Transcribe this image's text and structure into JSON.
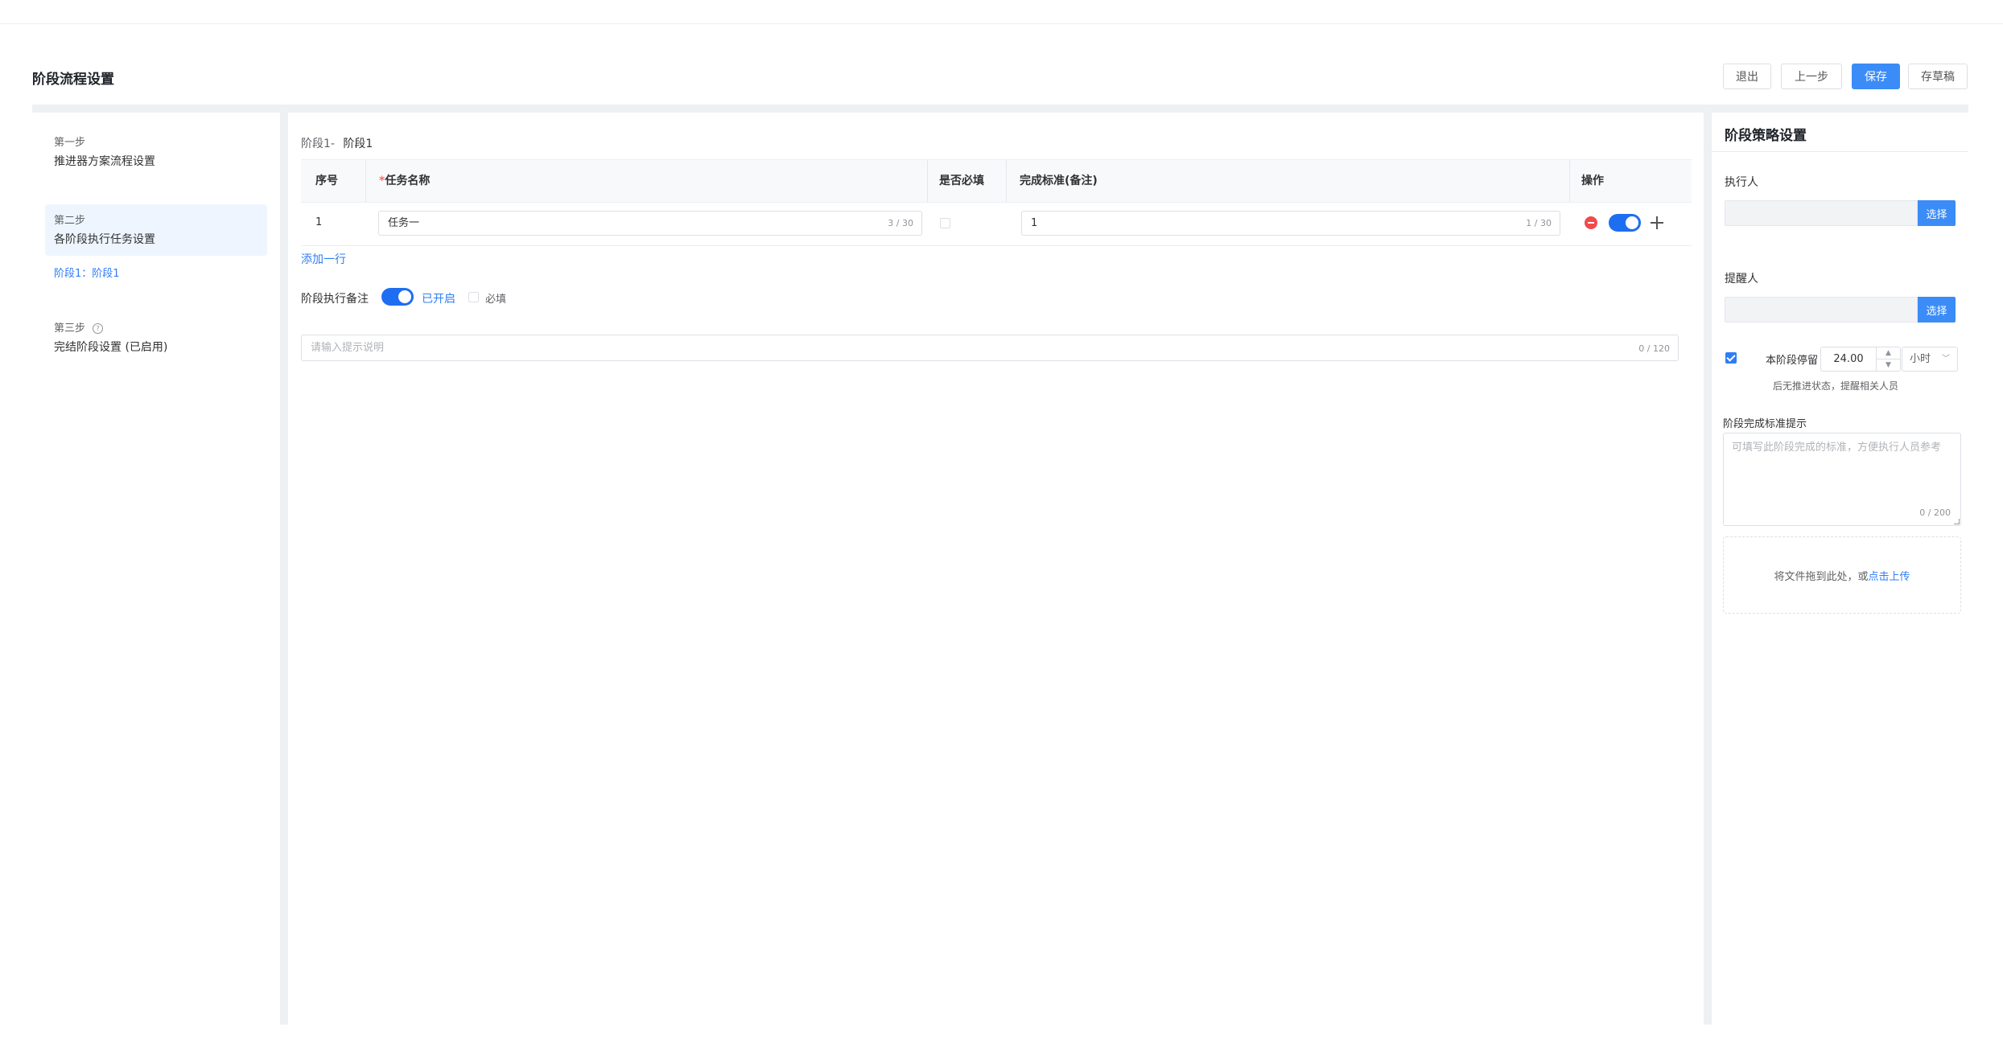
{
  "header": {
    "title": "阶段流程设置"
  },
  "toolbar": {
    "exit_label": "退出",
    "prev_label": "上一步",
    "save_label": "保存",
    "draft_label": "存草稿",
    "primary_color": "#3b8cf6"
  },
  "steps": [
    {
      "title": "第一步",
      "text": "推进器方案流程设置"
    },
    {
      "title": "第二步",
      "text": "各阶段执行任务设置",
      "active": true,
      "sub": "阶段1：阶段1"
    },
    {
      "title": "第三步",
      "help_icon": "question-circle-icon",
      "text": "完结阶段设置 (已启用)"
    }
  ],
  "stage": {
    "prefix": "阶段1-",
    "name": "阶段1",
    "table": {
      "headers": {
        "index": "序号",
        "required_mark": "*",
        "task": "任务名称",
        "mandatory": "是否必填",
        "standard": "完成标准(备注)",
        "ops": "操作"
      },
      "rows": [
        {
          "index": "1",
          "task": "任务一",
          "task_count": "3 / 30",
          "mandatory": false,
          "standard": "1",
          "standard_count": "1 / 30",
          "enabled": true
        }
      ]
    },
    "add_row_label": "添加一行",
    "remark": {
      "label": "阶段执行备注",
      "switch_on": true,
      "status_text": "已开启",
      "required_label": "必填",
      "required_checked": false
    },
    "hint_input": {
      "placeholder": "请输入提示说明",
      "count": "0 / 120"
    }
  },
  "strategy": {
    "title": "阶段策略设置",
    "executor_label": "执行人",
    "reminder_label": "提醒人",
    "select_label": "选择",
    "stay": {
      "checked": true,
      "label": "本阶段停留",
      "value": "24.00",
      "unit": "小时",
      "note": "后无推进状态，提醒相关人员"
    },
    "completion_hint": {
      "label": "阶段完成标准提示",
      "placeholder": "可填写此阶段完成的标准，方便执行人员参考",
      "count": "0 / 200"
    },
    "upload": {
      "text": "将文件拖到此处，或",
      "link": "点击上传"
    }
  }
}
